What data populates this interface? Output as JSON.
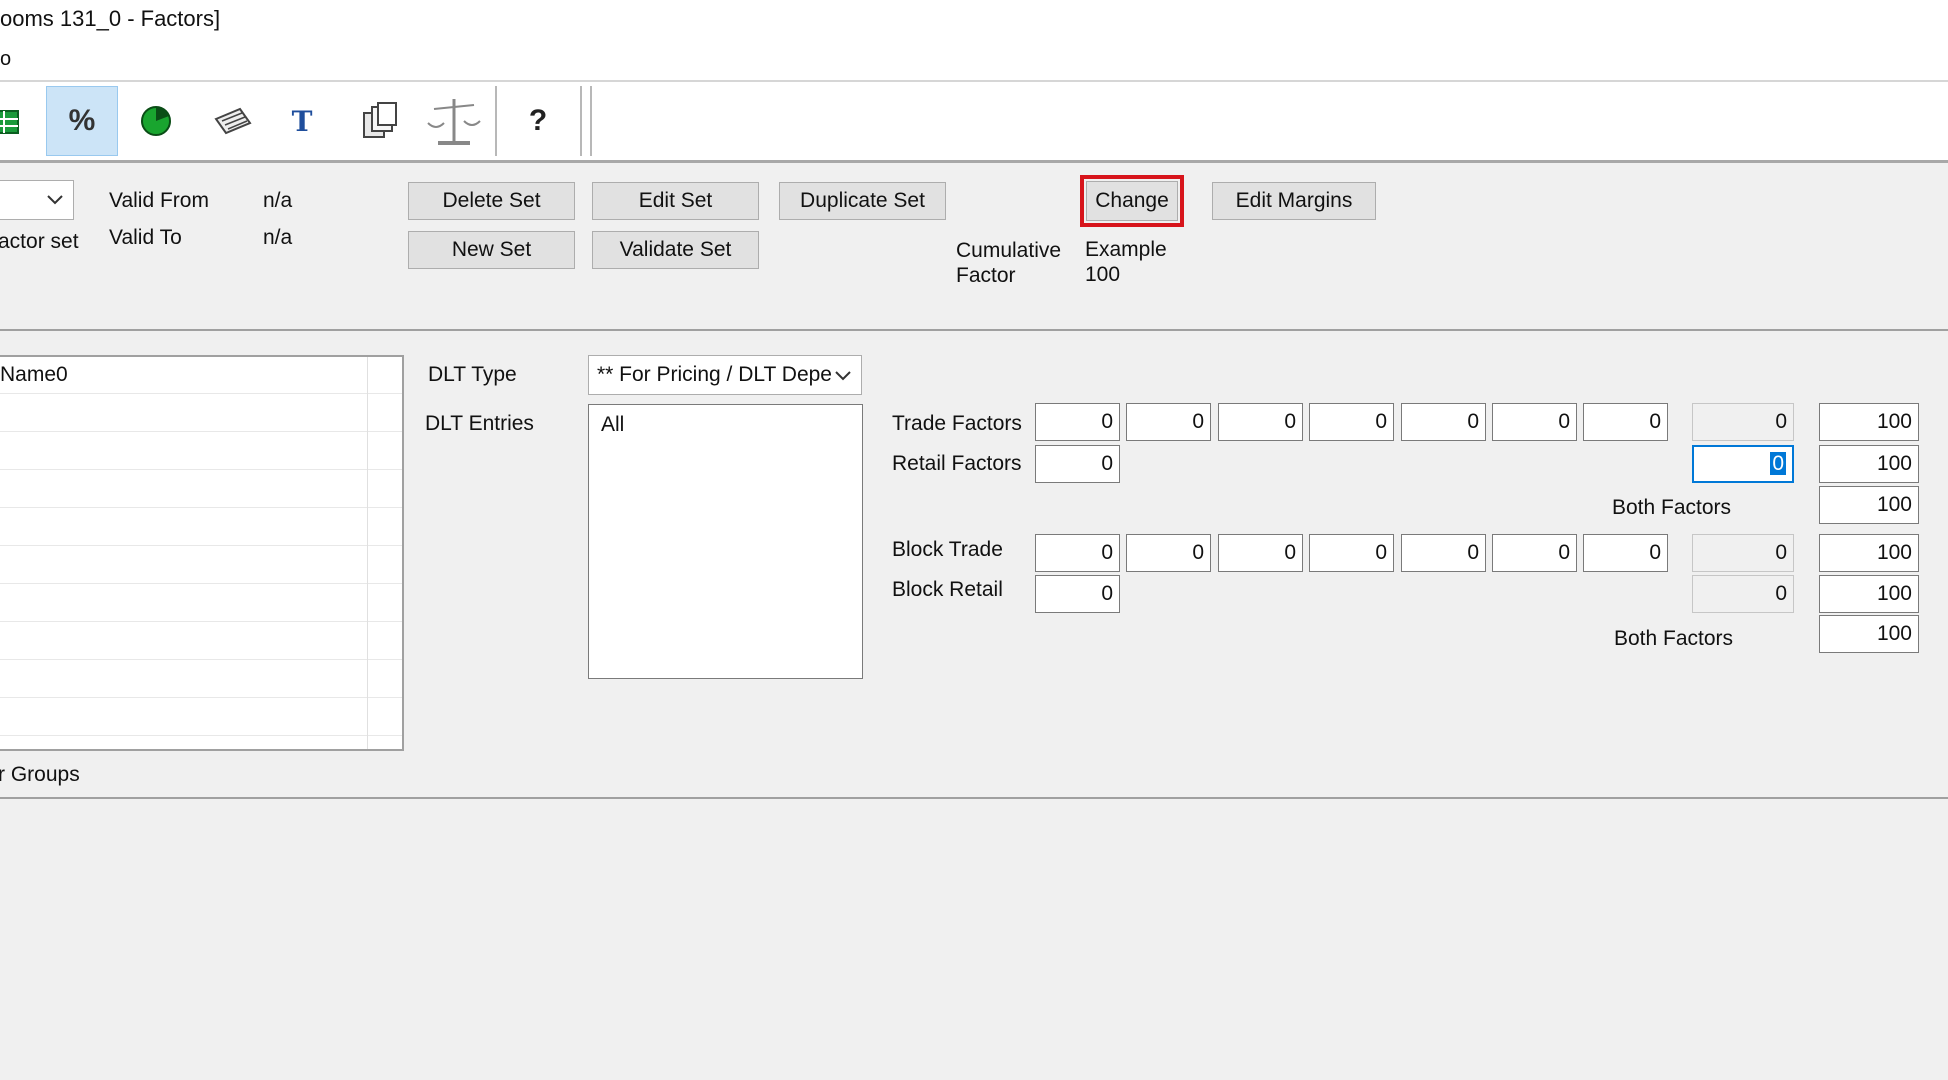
{
  "window": {
    "title": "ooms 131_0 - Factors]",
    "menu_fragment": "o"
  },
  "toolbar": {
    "buttons": [
      {
        "icon": "table-icon"
      },
      {
        "icon": "percent-icon",
        "label": "%",
        "active": true
      },
      {
        "icon": "pie-chart-icon"
      },
      {
        "icon": "keyboard-icon"
      },
      {
        "icon": "text-icon",
        "label": "T"
      },
      {
        "icon": "copy-pages-icon"
      },
      {
        "icon": "scales-icon"
      },
      {
        "icon": "help-icon",
        "label": "?"
      }
    ]
  },
  "factor_set": {
    "selector_label": "actor set",
    "valid_from_label": "Valid From",
    "valid_from_value": "n/a",
    "valid_to_label": "Valid To",
    "valid_to_value": "n/a",
    "buttons": {
      "delete_set": "Delete Set",
      "edit_set": "Edit Set",
      "duplicate_set": "Duplicate Set",
      "new_set": "New Set",
      "validate_set": "Validate Set",
      "change": "Change",
      "edit_margins": "Edit Margins"
    },
    "cumulative_factor_label": "Cumulative Factor",
    "example_label": "Example",
    "example_value": "100"
  },
  "groups": {
    "column_header": "Name0",
    "footer_label": "r Groups"
  },
  "dlt": {
    "type_label": "DLT Type",
    "type_value": "** For Pricing / DLT Depe",
    "entries_label": "DLT Entries",
    "entries": [
      "All"
    ]
  },
  "factors": {
    "trade_label": "Trade Factors",
    "retail_label": "Retail Factors",
    "both_label_1": "Both Factors",
    "block_trade_label": "Block Trade",
    "block_retail_label": "Block Retail",
    "both_label_2": "Both Factors",
    "trade_values": [
      "0",
      "0",
      "0",
      "0",
      "0",
      "0",
      "0"
    ],
    "trade_total": "0",
    "trade_result": "100",
    "retail_value": "0",
    "retail_total": "0",
    "retail_result": "100",
    "both_result_1": "100",
    "block_trade_values": [
      "0",
      "0",
      "0",
      "0",
      "0",
      "0",
      "0"
    ],
    "block_trade_total": "0",
    "block_trade_result": "100",
    "block_retail_value": "0",
    "block_retail_total": "0",
    "block_retail_result": "100",
    "both_result_2": "100"
  },
  "colors": {
    "highlight": "#d7141b",
    "focus": "#0078d7",
    "active_toolbar": "#cce4f7"
  }
}
